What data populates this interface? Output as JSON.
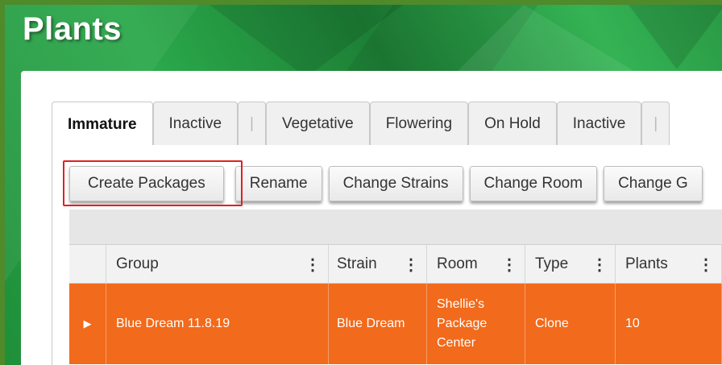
{
  "page": {
    "title": "Plants"
  },
  "tabs": [
    {
      "label": "Immature",
      "active": true
    },
    {
      "label": "Inactive",
      "active": false
    },
    {
      "label": "|",
      "active": false
    },
    {
      "label": "Vegetative",
      "active": false
    },
    {
      "label": "Flowering",
      "active": false
    },
    {
      "label": "On Hold",
      "active": false
    },
    {
      "label": "Inactive",
      "active": false
    },
    {
      "label": "|",
      "active": false
    }
  ],
  "toolbar": {
    "create_packages": "Create Packages",
    "rename": "Rename",
    "change_strains": "Change Strains",
    "change_room": "Change Room",
    "change_g": "Change G"
  },
  "table": {
    "columns": [
      "Group",
      "Strain",
      "Room",
      "Type",
      "Plants"
    ],
    "menu_icon": "⋮",
    "rows": [
      {
        "group": "Blue Dream 11.8.19",
        "strain": "Blue Dream",
        "room": "Shellie's Package Center",
        "type": "Clone",
        "plants": "10"
      }
    ]
  },
  "colors": {
    "accent_green": "#2aa84a",
    "selected_row": "#f26a1b",
    "highlight_box": "#e02020"
  }
}
